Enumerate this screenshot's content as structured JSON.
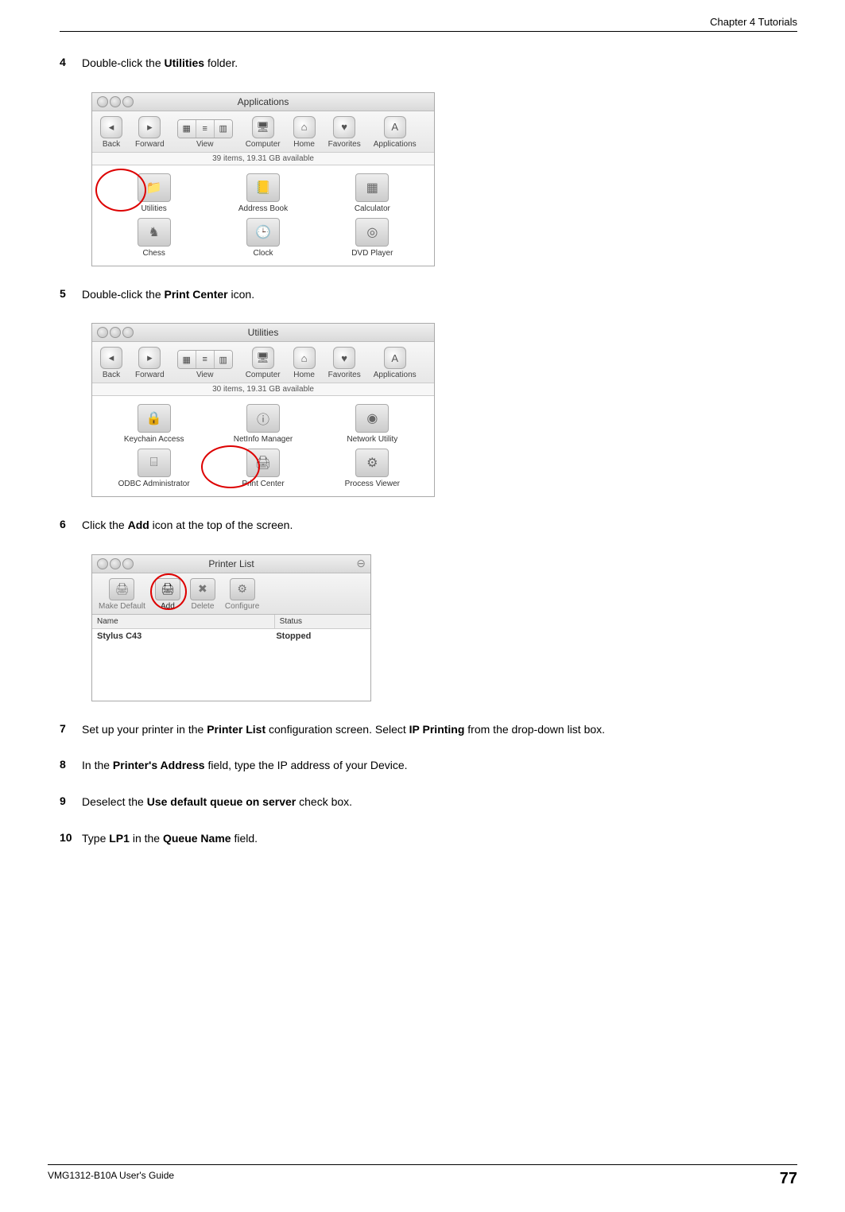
{
  "header": {
    "chapter": "Chapter 4 Tutorials"
  },
  "steps": [
    {
      "num": "4",
      "pre": "Double-click the ",
      "bold": "Utilities",
      "post": " folder."
    },
    {
      "num": "5",
      "pre": "Double-click the ",
      "bold": "Print Center",
      "post": " icon."
    },
    {
      "num": "6",
      "pre": "Click the ",
      "bold": "Add",
      "post": " icon at the top of the screen."
    },
    {
      "num": "7",
      "pre": "Set up your printer in the ",
      "bold": "Printer List",
      "mid": " configuration screen. Select ",
      "bold2": "IP Printing",
      "post": " from the drop-down list box."
    },
    {
      "num": "8",
      "pre": "In the ",
      "bold": "Printer's Address",
      "post": " field, type the IP address of your Device."
    },
    {
      "num": "9",
      "pre": "Deselect the ",
      "bold": "Use default queue on server",
      "post": " check box."
    },
    {
      "num": "10",
      "pre": "Type ",
      "bold": "LP1",
      "mid": " in the ",
      "bold2": "Queue Name",
      "post": " field."
    }
  ],
  "finder_app": {
    "title": "Applications",
    "toolbar": [
      "Back",
      "Forward",
      "View",
      "Computer",
      "Home",
      "Favorites",
      "Applications"
    ],
    "status": "39 items, 19.31 GB available",
    "items": [
      "Utilities",
      "Address Book",
      "Calculator",
      "Chess",
      "Clock",
      "DVD Player"
    ],
    "highlight": "Utilities"
  },
  "finder_util": {
    "title": "Utilities",
    "toolbar": [
      "Back",
      "Forward",
      "View",
      "Computer",
      "Home",
      "Favorites",
      "Applications"
    ],
    "status": "30 items, 19.31 GB available",
    "items": [
      "Keychain Access",
      "NetInfo Manager",
      "Network Utility",
      "ODBC Administrator",
      "Print Center",
      "Process Viewer"
    ],
    "highlight": "Print Center"
  },
  "printer_list": {
    "title": "Printer List",
    "toolbar": [
      {
        "label": "Make Default",
        "enabled": false
      },
      {
        "label": "Add",
        "enabled": true
      },
      {
        "label": "Delete",
        "enabled": false
      },
      {
        "label": "Configure",
        "enabled": false
      }
    ],
    "columns": [
      "Name",
      "Status"
    ],
    "rows": [
      {
        "name": "Stylus C43",
        "status": "Stopped"
      }
    ],
    "highlight": "Add"
  },
  "footer": {
    "guide": "VMG1312-B10A User's Guide",
    "page": "77"
  }
}
